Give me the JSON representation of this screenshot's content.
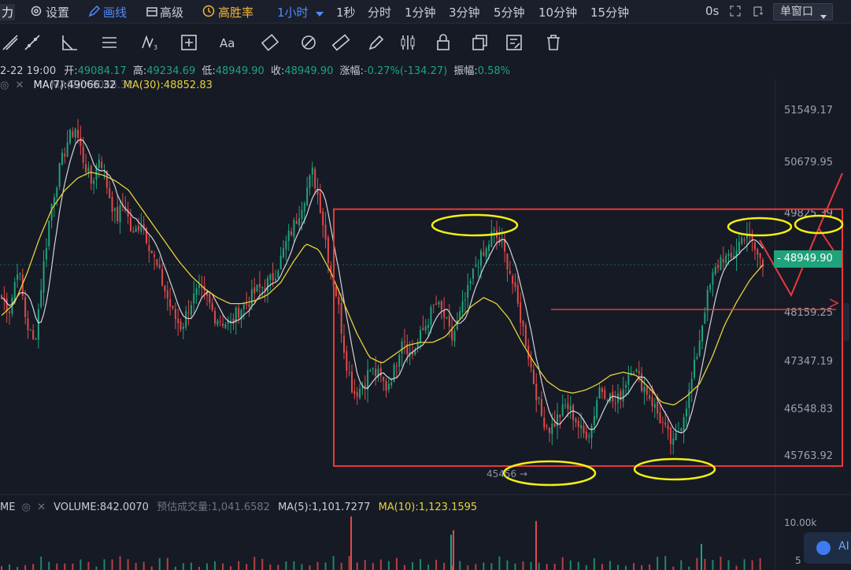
{
  "toolbar": {
    "partial_left": "力",
    "settings": "设置",
    "draw_line": "画线",
    "advanced": "高级",
    "high_win": "高胜率",
    "interval_active": "1小时",
    "intervals": [
      "1秒",
      "分时",
      "1分钟",
      "3分钟",
      "5分钟",
      "10分钟",
      "15分钟"
    ],
    "latency": "0s",
    "window_mode": "单窗口"
  },
  "draw_tools": [
    "trend-line-icon",
    "parallel-lines-icon",
    "angle-icon",
    "horizontal-lines-icon",
    "wave-icon",
    "measure-icon",
    "text-icon",
    "brush-icon",
    "eraser-icon",
    "ruler-icon",
    "pen-icon",
    "candle-icon",
    "lock-icon",
    "copy-icon",
    "edit-icon",
    "trash-icon"
  ],
  "ohlc": {
    "date": "2-22 19:00",
    "open_label": "开:",
    "open": "49084.17",
    "high_label": "高:",
    "high": "49234.69",
    "low_label": "低:",
    "low": "48949.90",
    "close_label": "收:",
    "close": "48949.90",
    "change_label": "涨幅:",
    "change": "-0.27%(-134.27)",
    "amplitude_label": "振幅:",
    "amplitude": "0.58%"
  },
  "ma": {
    "ma7": "MA(7):49066.32",
    "ma7_overlap": "MA(7):49066.32",
    "ma30": "MA(30):48852.83"
  },
  "volume": {
    "tag": "ME",
    "label": "VOLUME:842.0070",
    "est_label": "预估成交量:",
    "est_value": "1,041.6582",
    "ma5": "MA(5):1,101.7277",
    "ma10": "MA(10):1,123.1595"
  },
  "current_price": "48949.90",
  "low_marker": "45456",
  "ai": "AI",
  "colors": {
    "up": "#1fa37a",
    "down": "#e04a4a",
    "ma7": "#e8e8ee",
    "ma30": "#e6d23a",
    "annotation_red": "#e83a3a",
    "annotation_yellow": "#f2f014"
  },
  "chart_data": {
    "type": "candlestick",
    "interval": "1小时",
    "y_ticks": [
      51549.17,
      50679.95,
      49825.39,
      48159.25,
      47347.19,
      46548.83,
      45763.92
    ],
    "ylim": [
      45300,
      51900
    ],
    "volume_ticks": [
      "10.00k",
      "5"
    ],
    "current_price": 48949.9,
    "low_marker": 45456,
    "close_path": [
      48400,
      48200,
      48950,
      48000,
      47600,
      48800,
      49900,
      50500,
      51000,
      51250,
      50700,
      50300,
      50800,
      50200,
      49700,
      50000,
      49400,
      49700,
      49300,
      48900,
      48500,
      48100,
      47900,
      48300,
      48500,
      48400,
      48100,
      48000,
      47950,
      48200,
      48300,
      48500,
      48600,
      48700,
      49000,
      49400,
      49700,
      50100,
      50500,
      49900,
      49000,
      48400,
      47400,
      46800,
      46900,
      47200,
      47100,
      46900,
      47200,
      47800,
      47400,
      47700,
      48000,
      48300,
      48100,
      47700,
      48100,
      48500,
      49000,
      49100,
      49500,
      49300,
      48900,
      48300,
      47700,
      47000,
      46400,
      46200,
      46400,
      46600,
      46400,
      46100,
      46200,
      46900,
      46800,
      46600,
      46900,
      47300,
      47000,
      46800,
      46500,
      46200,
      45900,
      46300,
      46800,
      47500,
      48300,
      48800,
      49100,
      49000,
      49300,
      49500,
      49200,
      48950
    ],
    "ma30_path": [
      48100,
      48300,
      48800,
      49400,
      49900,
      50200,
      50400,
      50500,
      50450,
      50350,
      50200,
      49900,
      49600,
      49300,
      49000,
      48750,
      48550,
      48400,
      48300,
      48300,
      48350,
      48450,
      48650,
      49000,
      49300,
      49200,
      48800,
      48300,
      47800,
      47400,
      47300,
      47450,
      47600,
      47650,
      47650,
      47750,
      48000,
      48250,
      48400,
      48300,
      48050,
      47650,
      47300,
      47000,
      46850,
      46800,
      46850,
      46950,
      47100,
      47150,
      47100,
      46900,
      46650,
      46600,
      46750,
      46950,
      47400,
      47950,
      48350,
      48700,
      48949
    ],
    "volume_spikes": [
      1,
      0.6,
      0.9,
      0.4,
      0.7
    ]
  }
}
